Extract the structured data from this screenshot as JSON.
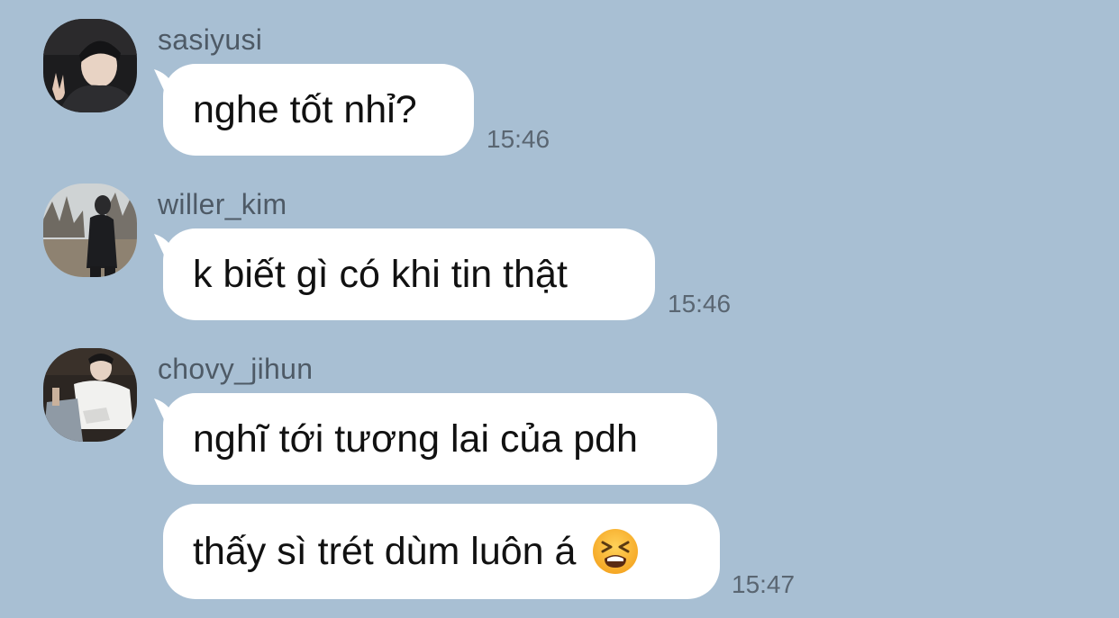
{
  "messages": [
    {
      "username": "sasiyusi",
      "text": "nghe tốt nhỉ?",
      "time": "15:46",
      "avatar_icon": "person-selfie-avatar"
    },
    {
      "username": "willer_kim",
      "text": "k biết gì có khi tin thật",
      "time": "15:46",
      "avatar_icon": "person-outdoor-avatar"
    },
    {
      "username": "chovy_jihun",
      "text": "nghĩ tới tương lai của pdh",
      "time": "",
      "avatar_icon": "person-sitting-avatar"
    },
    {
      "username": "",
      "text": "thấy sì trét dùm luôn á",
      "time": "15:47",
      "emoji": "tired-face-emoji"
    }
  ],
  "colors": {
    "background": "#a8bfd3",
    "bubble": "#ffffff",
    "username": "#4e5a66",
    "timestamp": "#5a6672"
  }
}
